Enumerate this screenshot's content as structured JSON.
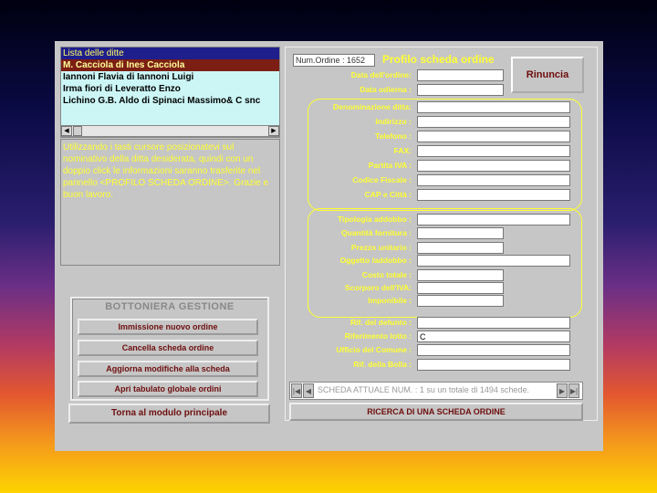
{
  "list": {
    "header": "Lista delle ditte",
    "items": [
      "M. Cacciola di Ines Cacciola",
      "Iannoni Flavia di Iannoni Luigi",
      "Irma fiori di Leveratto Enzo",
      "Lichino G.B. Aldo di Spinaci Massimo& C snc"
    ]
  },
  "instructions": "Utilizzando i tasti cursore posizionatevi sul nominativo della ditta desiderata, quindi con un doppio click le informazioni saranno trasferite nel pannello <PROFILO SCHEDA ORDINE>. Grazie e buon lavoro.",
  "bottoniera": {
    "title": "BOTTONIERA GESTIONE",
    "buttons": [
      "Immissione nuovo ordine",
      "Cancella scheda ordine",
      "Aggiorna modifiche alla scheda",
      "Apri tabulato globale ordini"
    ]
  },
  "main_button": "Torna al modulo principale",
  "profilo": {
    "num_ordine": "Num.Ordine : 1652",
    "title": "Profilo scheda ordine",
    "rinuncia": "Rinuncia",
    "date_labels": [
      "Data dell'ordine:",
      "Data odierna :"
    ],
    "ditta_labels": [
      "Denominazione ditta:",
      "Indirizzo :",
      "Telefono :",
      "FAX:",
      "Partita IVA :",
      "Codice Fiscale :",
      "CAP e Città :"
    ],
    "addobbo_labels": [
      "Tipologia addobbo :",
      "Quantità fornitura :",
      "Prezzo unitario :",
      "Oggetto /addobbo :",
      "Costo totale :",
      "Scorporo dell'IVA:",
      "Imponibile :"
    ],
    "rif_labels": [
      "Rif. del defunto :",
      "Riferimento lotto :",
      "Ufficio del Comune :",
      "Rif. della Bolla :"
    ],
    "riferimento_lotto_value": "C",
    "status_text": "SCHEDA ATTUALE NUM. : 1 su un totale di  1494 schede.",
    "ricerca": "RICERCA DI UNA SCHEDA ORDINE"
  }
}
